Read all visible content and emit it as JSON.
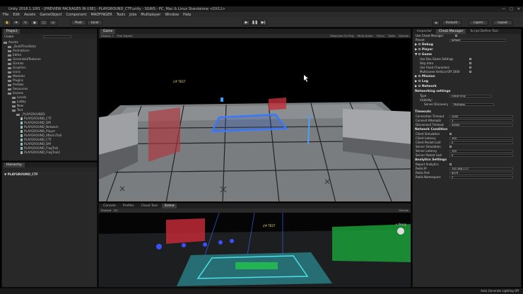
{
  "window": {
    "title": "Unity 2018.1.10f1 - [PREVIEW PACKAGES IN USE] - PLAYGROUND_CTF.unity - SGWS - PC, Mac & Linux Standalone <DX11>"
  },
  "menu": [
    "File",
    "Edit",
    "Assets",
    "GameObject",
    "Component",
    "MADFINGER",
    "Tools",
    "Jobs",
    "Multiplayer",
    "Window",
    "Help"
  ],
  "toolbar": {
    "pivot": "Pivot",
    "local": "Local",
    "account": "Account",
    "layers": "Layers",
    "layout": "Layout"
  },
  "project": {
    "tab": "Project",
    "create": "Create",
    "items": [
      {
        "label": "Assets",
        "indent": 0,
        "kind": "folder"
      },
      {
        "label": "_BuildTimeData",
        "indent": 1,
        "kind": "folder"
      },
      {
        "label": "Animations",
        "indent": 1,
        "kind": "folder"
      },
      {
        "label": "Editor",
        "indent": 1,
        "kind": "folder"
      },
      {
        "label": "GeneratedTextures",
        "indent": 1,
        "kind": "folder"
      },
      {
        "label": "Gizmos",
        "indent": 1,
        "kind": "folder"
      },
      {
        "label": "Graphics",
        "indent": 1,
        "kind": "folder"
      },
      {
        "label": "Icons",
        "indent": 1,
        "kind": "folder"
      },
      {
        "label": "Modules",
        "indent": 1,
        "kind": "folder"
      },
      {
        "label": "Plugins",
        "indent": 1,
        "kind": "folder"
      },
      {
        "label": "Prefabs",
        "indent": 1,
        "kind": "folder"
      },
      {
        "label": "Resources",
        "indent": 1,
        "kind": "folder"
      },
      {
        "label": "Scenes",
        "indent": 1,
        "kind": "folder"
      },
      {
        "label": "Levels",
        "indent": 2,
        "kind": "folder"
      },
      {
        "label": "Lobby",
        "indent": 2,
        "kind": "folder"
      },
      {
        "label": "New",
        "indent": 2,
        "kind": "folder"
      },
      {
        "label": "Test",
        "indent": 2,
        "kind": "folder"
      },
      {
        "label": "_PLAYGROUNDS",
        "indent": 3,
        "kind": "folder"
      },
      {
        "label": "PLAYGROUND_CTF",
        "indent": 4,
        "kind": "file"
      },
      {
        "label": "PLAYGROUND_DM",
        "indent": 4,
        "kind": "file"
      },
      {
        "label": "PLAYGROUND_Network",
        "indent": 4,
        "kind": "file"
      },
      {
        "label": "PLAYGROUND_Player",
        "indent": 4,
        "kind": "file"
      },
      {
        "label": "PLAYGROUND_AfterinTrail",
        "indent": 4,
        "kind": "file"
      },
      {
        "label": "PLAYGROUND_CTF",
        "indent": 4,
        "kind": "file"
      },
      {
        "label": "PLAYGROUND_DM",
        "indent": 4,
        "kind": "file"
      },
      {
        "label": "PLAYGROUND_FlagTrail",
        "indent": 4,
        "kind": "file"
      },
      {
        "label": "PLAYGROUND_FlagTrail2",
        "indent": 4,
        "kind": "file"
      }
    ]
  },
  "hierarchy": {
    "tab": "Hierarchy",
    "scene": "PLAYGROUND_CTF"
  },
  "game": {
    "tab": "Game",
    "display": "Display 1",
    "aspect": "Free Aspect",
    "options": [
      "Maximize On Play",
      "Mute Audio",
      "VSync",
      "Stats",
      "Gizmos"
    ],
    "marker_top": "//# TEST",
    "marker_bottom": "//# TEST"
  },
  "bottom_tabs": [
    "Console",
    "Profiler",
    "Cloud Tool",
    "Scene"
  ],
  "scene": {
    "shading": "Shaded",
    "mode": "2D",
    "gizmos": "Gizmos",
    "persp": "< Persp"
  },
  "inspector": {
    "tabs": [
      "Inspector",
      "Cheat Manager",
      "Script Define Tool"
    ],
    "use_cheat_manager": "Use Cheat Manager",
    "preset_label": "Preset",
    "preset_value": "default",
    "sections": [
      {
        "label": "Debug",
        "rows": []
      },
      {
        "label": "Player",
        "rows": []
      },
      {
        "label": "Game",
        "rows": [
          {
            "label": "Use Dev Game Settings",
            "value": ""
          },
          {
            "label": "Skip Intro",
            "value": ""
          },
          {
            "label": "Use Fixed Characters",
            "value": ""
          },
          {
            "label": "Multiscene Vertical Off 1000",
            "value": ""
          }
        ]
      },
      {
        "label": "Mission",
        "rows": []
      },
      {
        "label": "Log",
        "rows": []
      },
      {
        "label": "Network",
        "rows": []
      }
    ],
    "networking_settings": "Networking settings",
    "type_label": "Type",
    "type_value": "Client Only",
    "visibility_label": "Visibility:",
    "server_discovery_label": "Server Discovery",
    "server_discovery_value": "Multiplay",
    "timeouts": "Timeouts",
    "timeout_rows": [
      {
        "label": "Connection Timeout",
        "value": "1000"
      },
      {
        "label": "Connect Attempts",
        "value": "3"
      },
      {
        "label": "Disconnect Timeout",
        "value": "30000"
      }
    ],
    "network_condition": "Network Condition",
    "condition_rows": [
      {
        "label": "Client Simulation",
        "value": ""
      },
      {
        "label": "Client Latency",
        "value": "100"
      },
      {
        "label": "Client Packet Lost",
        "value": "0"
      },
      {
        "label": "Server Simulation",
        "value": ""
      },
      {
        "label": "Server Latency",
        "value": "100"
      },
      {
        "label": "Server Packet Lost",
        "value": "0"
      }
    ],
    "analytics": "Analytics Settings",
    "analytics_rows": [
      {
        "label": "Report Analytics",
        "value": ""
      },
      {
        "label": "Redis IP",
        "value": "192.168.1.17"
      },
      {
        "label": "Redis Port",
        "value": "6379"
      },
      {
        "label": "Redis Namespace",
        "value": "2"
      }
    ]
  },
  "status": "Auto Generate Lighting Off"
}
